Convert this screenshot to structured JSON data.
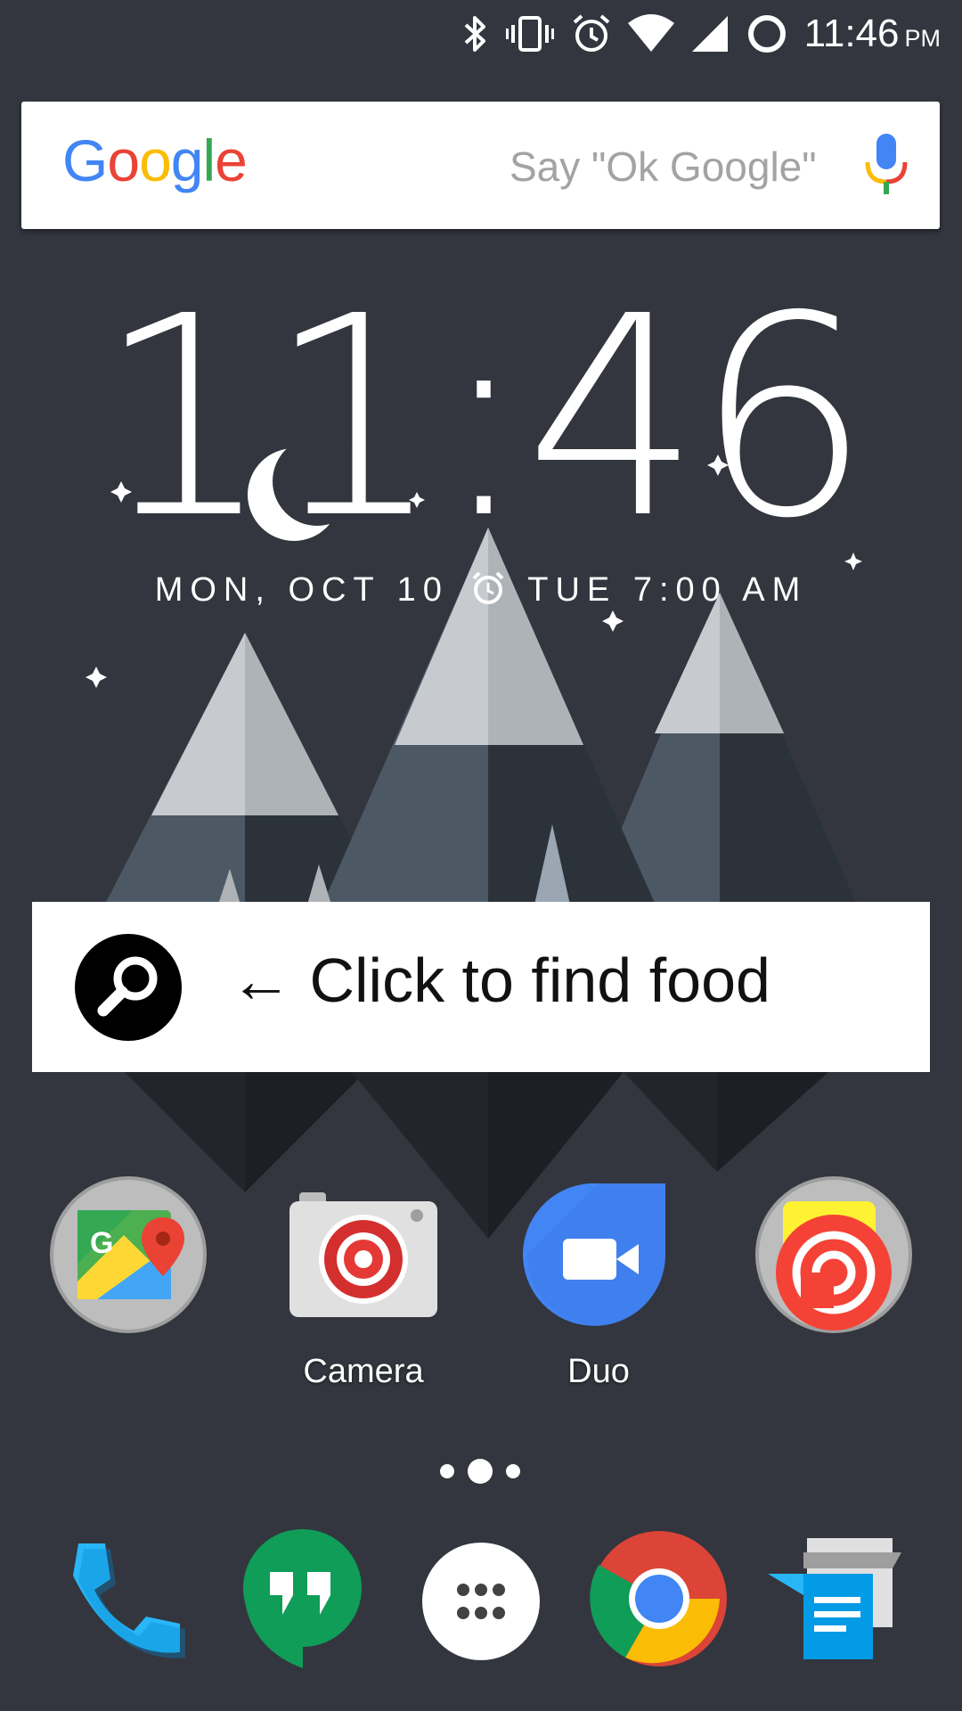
{
  "status_bar": {
    "time": "11:46",
    "ampm": "PM",
    "icons": [
      "bluetooth-icon",
      "vibrate-icon",
      "alarm-icon",
      "wifi-icon",
      "signal-icon",
      "battery-icon"
    ]
  },
  "search_bar": {
    "logo_letters": [
      {
        "char": "G",
        "color": "#4285F4"
      },
      {
        "char": "o",
        "color": "#EA4335"
      },
      {
        "char": "o",
        "color": "#FBBC05"
      },
      {
        "char": "g",
        "color": "#4285F4"
      },
      {
        "char": "l",
        "color": "#34A853"
      },
      {
        "char": "e",
        "color": "#EA4335"
      }
    ],
    "hint": "Say \"Ok Google\""
  },
  "clock": {
    "time": "11:46",
    "date": "MON, OCT 10",
    "alarm": "TUE 7:00 AM"
  },
  "food_banner": {
    "text": "← Click to find food"
  },
  "apps": [
    {
      "name": "Maps",
      "label": ""
    },
    {
      "name": "Camera",
      "label": "Camera"
    },
    {
      "name": "Duo",
      "label": "Duo"
    },
    {
      "name": "Podcast",
      "label": ""
    }
  ],
  "dock": [
    "phone-icon",
    "hangouts-icon",
    "app-drawer-icon",
    "chrome-icon",
    "messages-icon"
  ],
  "colors": {
    "background": "#33363e",
    "accent_red": "#EA4335",
    "accent_blue": "#4285F4"
  }
}
